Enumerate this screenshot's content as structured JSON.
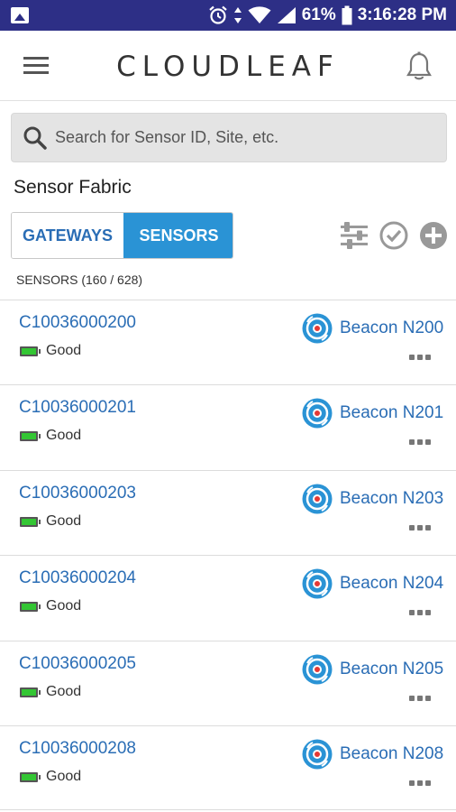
{
  "status_bar": {
    "battery_percent": "61%",
    "time": "3:16:28 PM"
  },
  "header": {
    "logo_text": "CLOUDLEAF"
  },
  "search": {
    "placeholder": "Search for Sensor ID, Site, etc."
  },
  "section_title": "Sensor Fabric",
  "tabs": [
    {
      "label": "GATEWAYS",
      "active": false
    },
    {
      "label": "SENSORS",
      "active": true
    }
  ],
  "toolbar": {
    "icons": [
      "filter-sliders-icon",
      "check-circle-icon",
      "add-circle-icon"
    ]
  },
  "count_label": "SENSORS (160 / 628)",
  "colors": {
    "status_bar": "#2d2f86",
    "accent_blue": "#2a93d5",
    "link_blue": "#2a6db5",
    "battery_green": "#33c633"
  },
  "sensors": [
    {
      "id": "C10036000200",
      "battery": "Good",
      "beacon": "Beacon N200"
    },
    {
      "id": "C10036000201",
      "battery": "Good",
      "beacon": "Beacon N201"
    },
    {
      "id": "C10036000203",
      "battery": "Good",
      "beacon": "Beacon N203"
    },
    {
      "id": "C10036000204",
      "battery": "Good",
      "beacon": "Beacon N204"
    },
    {
      "id": "C10036000205",
      "battery": "Good",
      "beacon": "Beacon N205"
    },
    {
      "id": "C10036000208",
      "battery": "Good",
      "beacon": "Beacon N208"
    }
  ]
}
